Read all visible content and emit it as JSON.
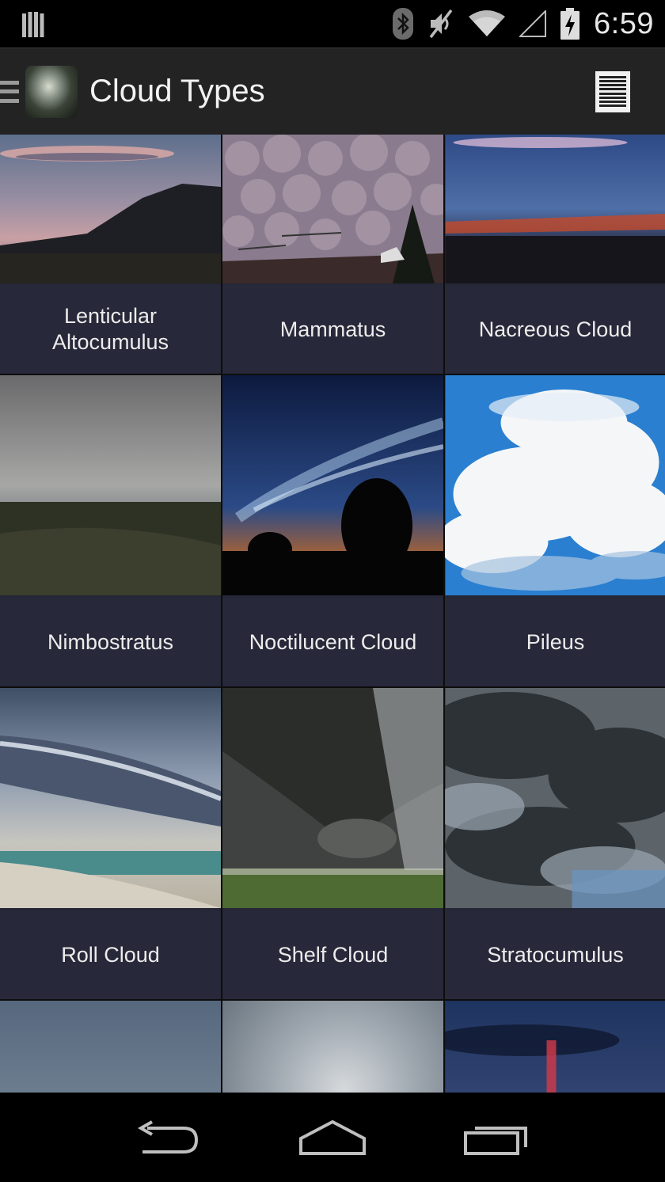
{
  "status_bar": {
    "time": "6:59",
    "icons": [
      "notification-icon",
      "bluetooth-icon",
      "mute-icon",
      "wifi-icon",
      "signal-icon",
      "battery-charging-icon"
    ]
  },
  "action_bar": {
    "title": "Cloud Types",
    "drawer_icon": "drawer-menu-icon",
    "app_icon": "cloud-app-icon",
    "view_toggle_icon": "list-view-icon"
  },
  "grid": {
    "items": [
      {
        "label": "Lenticular Altocumulus",
        "image": "lenticular-altocumulus-photo"
      },
      {
        "label": "Mammatus",
        "image": "mammatus-photo"
      },
      {
        "label": "Nacreous Cloud",
        "image": "nacreous-cloud-photo"
      },
      {
        "label": "Nimbostratus",
        "image": "nimbostratus-photo"
      },
      {
        "label": "Noctilucent Cloud",
        "image": "noctilucent-cloud-photo"
      },
      {
        "label": "Pileus",
        "image": "pileus-photo"
      },
      {
        "label": "Roll Cloud",
        "image": "roll-cloud-photo"
      },
      {
        "label": "Shelf Cloud",
        "image": "shelf-cloud-photo"
      },
      {
        "label": "Stratocumulus",
        "image": "stratocumulus-photo"
      }
    ]
  },
  "nav_bar": {
    "icons": [
      "back-icon",
      "home-icon",
      "recent-apps-icon"
    ]
  }
}
